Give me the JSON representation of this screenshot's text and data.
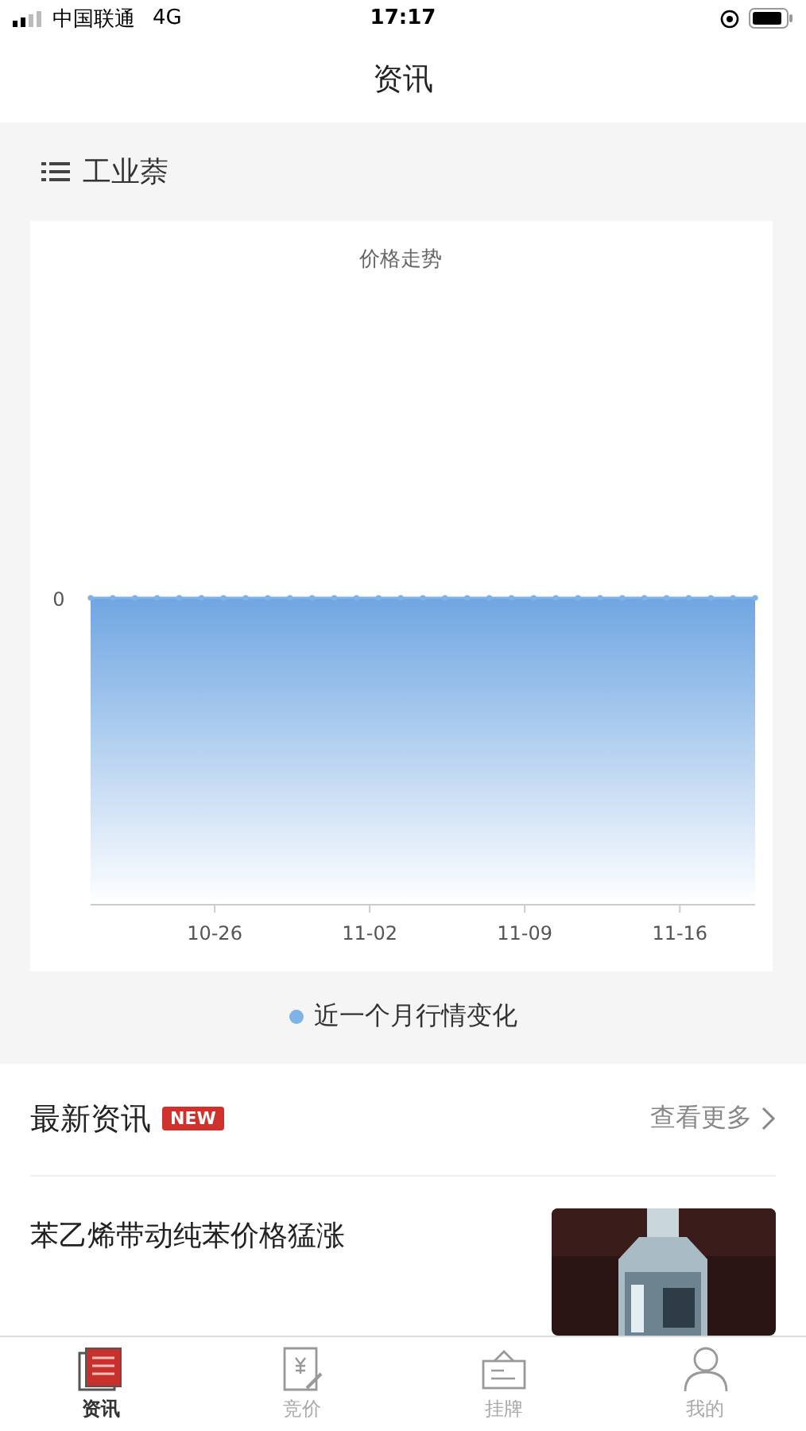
{
  "status_bar": {
    "carrier": "中国联通",
    "network": "4G",
    "time": "17:17"
  },
  "nav": {
    "title": "资讯"
  },
  "product": {
    "name": "工业萘"
  },
  "chart": {
    "title": "价格走势",
    "y_label": "0",
    "x_labels": [
      "10-26",
      "11-02",
      "11-09",
      "11-16"
    ],
    "legend": "近一个月行情变化"
  },
  "news": {
    "title": "最新资讯",
    "badge": "NEW",
    "more": "查看更多",
    "items": [
      {
        "title": "苯乙烯带动纯苯价格猛涨"
      }
    ]
  },
  "tabs": [
    {
      "label": "资讯",
      "kind": "newspaper",
      "selected": true
    },
    {
      "label": "竞价",
      "kind": "price",
      "selected": false
    },
    {
      "label": "挂牌",
      "kind": "sign",
      "selected": false
    },
    {
      "label": "我的",
      "kind": "person",
      "selected": false
    }
  ]
}
